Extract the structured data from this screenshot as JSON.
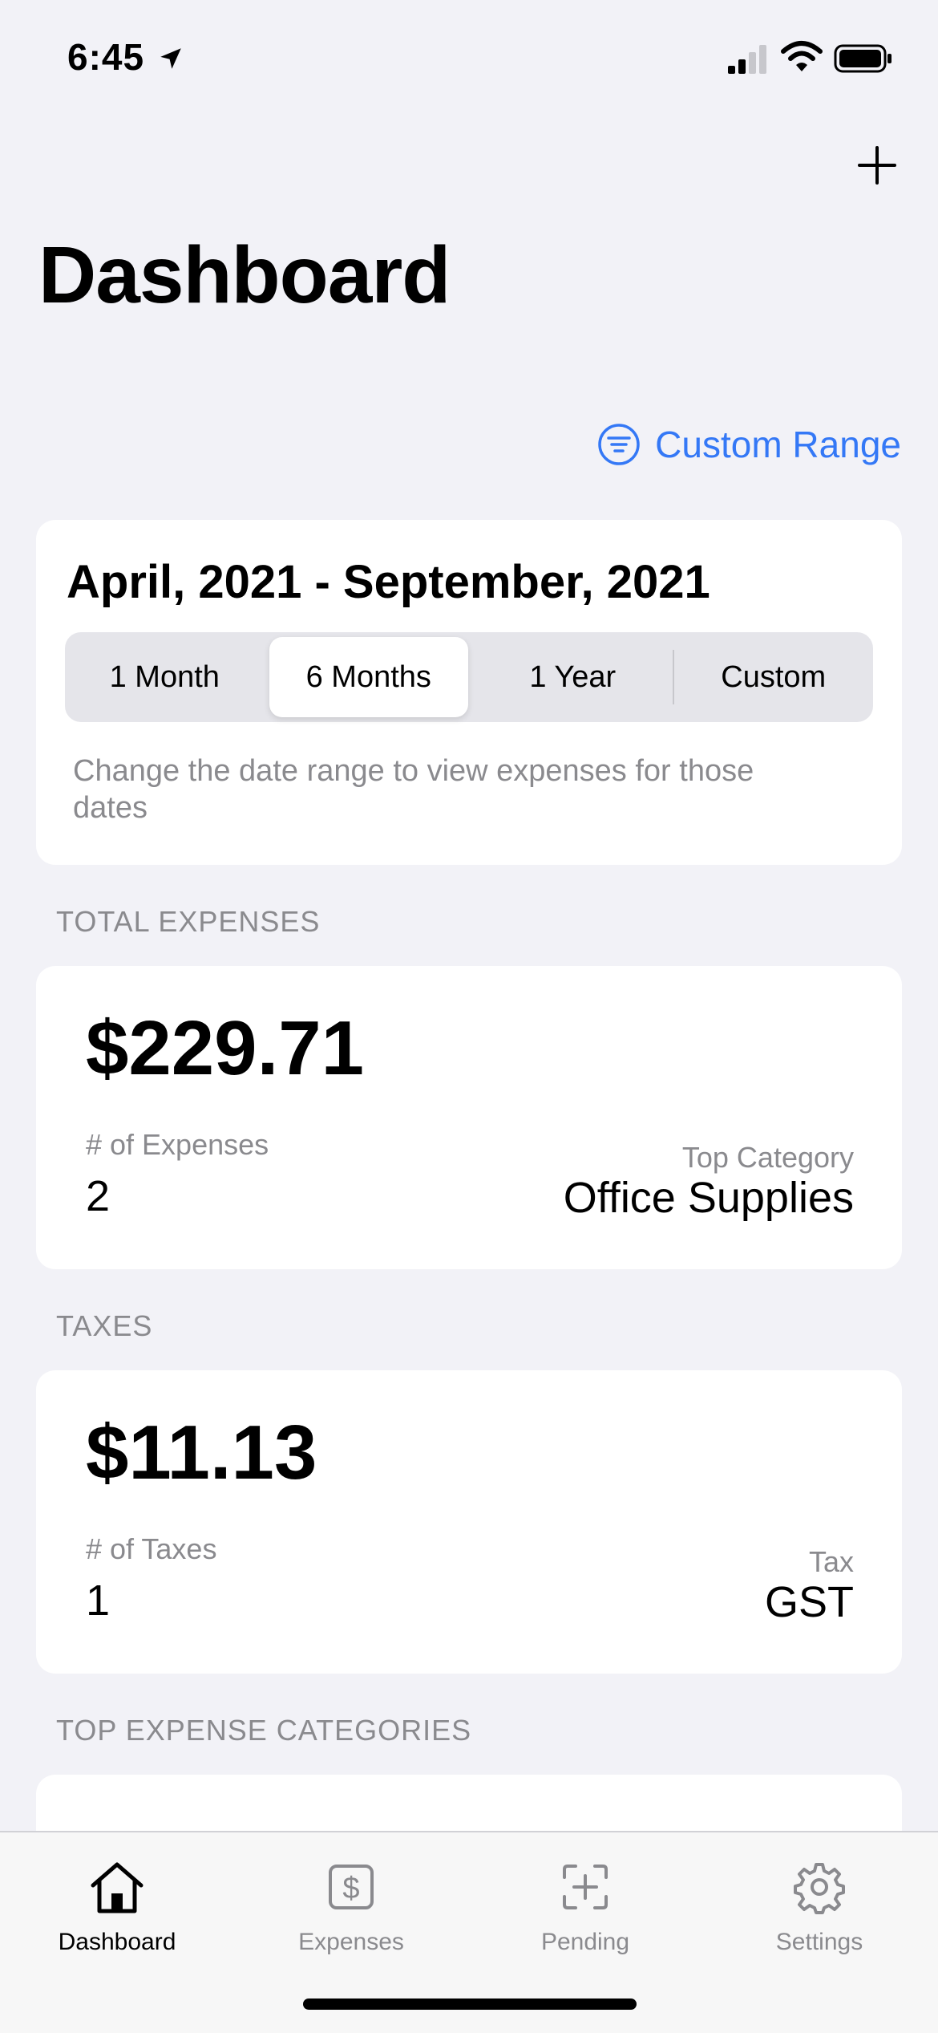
{
  "status_bar": {
    "time": "6:45",
    "icons": [
      "location-arrow-icon",
      "cellular-signal-icon",
      "wifi-icon",
      "battery-icon"
    ]
  },
  "header": {
    "add_icon": "plus-icon",
    "title": "Dashboard"
  },
  "filter": {
    "icon": "filter-circle-icon",
    "label": "Custom Range",
    "color": "#3478f6"
  },
  "date_card": {
    "range_title": "April, 2021 - September, 2021",
    "segments": [
      "1 Month",
      "6 Months",
      "1 Year",
      "Custom"
    ],
    "selected_segment": "6 Months",
    "help_text": "Change the date range to view expenses for those dates"
  },
  "total_expenses": {
    "header": "TOTAL EXPENSES",
    "amount": "$229.71",
    "count_label": "# of Expenses",
    "count_value": "2",
    "top_label": "Top Category",
    "top_value": "Office Supplies"
  },
  "taxes": {
    "header": "TAXES",
    "amount": "$11.13",
    "count_label": "# of Taxes",
    "count_value": "1",
    "top_label": "Tax",
    "top_value": "GST"
  },
  "categories": {
    "header": "TOP EXPENSE CATEGORIES"
  },
  "tab_bar": {
    "tabs": [
      {
        "label": "Dashboard",
        "icon": "house-icon",
        "active": true
      },
      {
        "label": "Expenses",
        "icon": "dollar-square-icon",
        "active": false
      },
      {
        "label": "Pending",
        "icon": "scan-plus-icon",
        "active": false
      },
      {
        "label": "Settings",
        "icon": "gear-icon",
        "active": false
      }
    ]
  }
}
